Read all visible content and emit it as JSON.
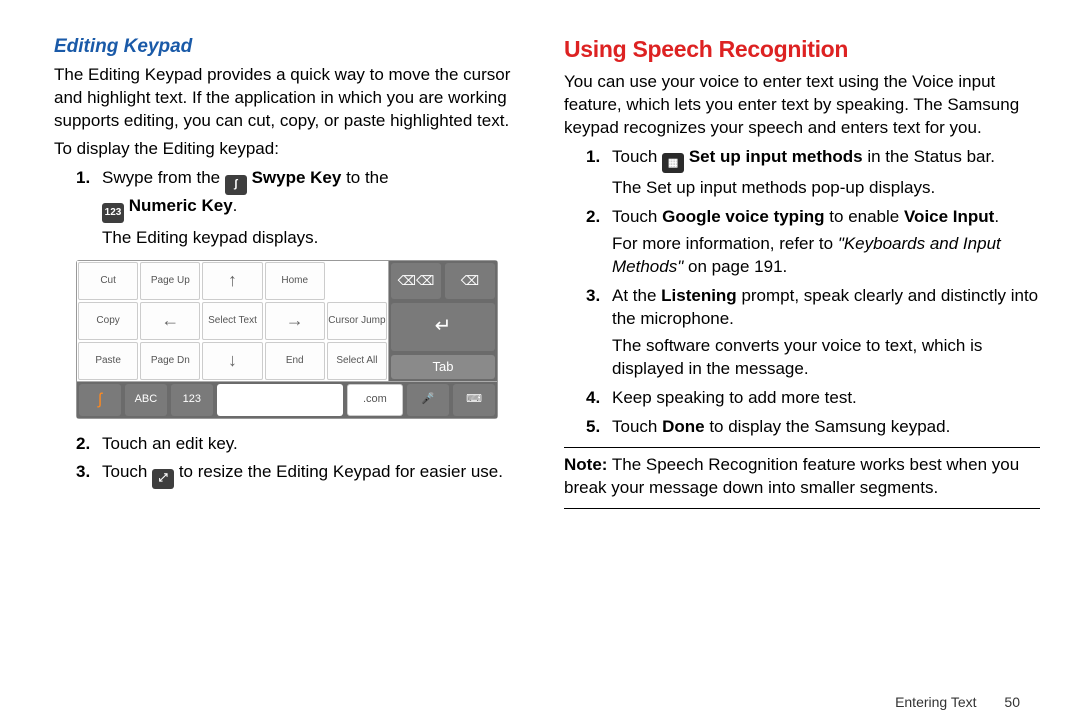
{
  "left": {
    "heading": "Editing Keypad",
    "intro": "The Editing Keypad provides a quick way to move the cursor and highlight text. If the application in which you are working supports editing, you can cut, copy, or paste highlighted text.",
    "display": "To display the Editing keypad:",
    "step1a": "Swype from the ",
    "step1_swype_key": "Swype Key",
    "step1b": " to the ",
    "step1_numeric_key": "Numeric Key",
    "step1c": ".",
    "step1_result": "The Editing keypad displays.",
    "step2": "Touch an edit key.",
    "step3a": "Touch ",
    "step3b": " to resize the Editing Keypad for easier use.",
    "keypad": {
      "r1": [
        "Cut",
        "Page Up",
        "↑",
        "Home"
      ],
      "r2": [
        "Copy",
        "←",
        "Select Text",
        "→",
        "Cursor Jump"
      ],
      "r3": [
        "Paste",
        "Page Dn",
        "↓",
        "End",
        "Select All"
      ],
      "right_top": [
        "⌫⌫",
        "⌫"
      ],
      "right_enter": "↵",
      "right_tab": "Tab",
      "bottom_swype": "ʃ",
      "bottom_abc": "ABC",
      "bottom_123": "123",
      "bottom_com": ".com",
      "bottom_mic": "🎤",
      "bottom_kbd": "⌨"
    }
  },
  "right": {
    "heading": "Using Speech Recognition",
    "intro": "You can use your voice to enter text using the Voice input feature, which lets you enter text by speaking. The Samsung keypad recognizes your speech and enters text for you.",
    "step1a": "Touch ",
    "step1_bold": "Set up input methods",
    "step1b": " in the Status bar.",
    "step1_result": "The Set up input methods pop-up displays.",
    "step2a": "Touch ",
    "step2_bold1": "Google voice typing",
    "step2b": " to enable ",
    "step2_bold2": "Voice Input",
    "step2c": ".",
    "step2_more_a": "For more information, refer to ",
    "step2_more_ital": "\"Keyboards and Input Methods\"",
    "step2_more_b": "  on page 191.",
    "step3a": "At the ",
    "step3_bold": "Listening",
    "step3b": " prompt, speak clearly and distinctly into the microphone.",
    "step3_result": "The software converts your voice to text, which is displayed in the message.",
    "step4": "Keep speaking to add more test.",
    "step5a": "Touch ",
    "step5_bold": "Done",
    "step5b": " to display the Samsung keypad.",
    "note_label": "Note:",
    "note": " The Speech Recognition feature works best when you break your message down into smaller segments."
  },
  "footer": {
    "section": "Entering Text",
    "page": "50"
  },
  "icons": {
    "n123": "123"
  }
}
